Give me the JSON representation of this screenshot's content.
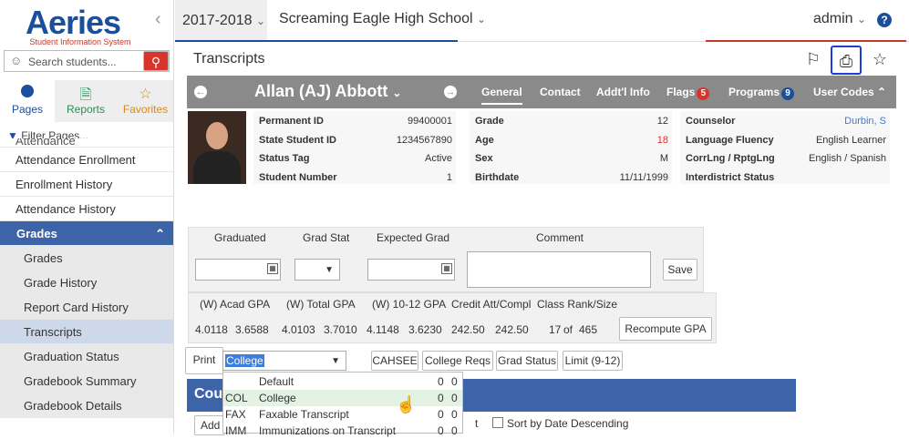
{
  "sidebar": {
    "logo_main": "Aeries",
    "logo_sub": "Student Information System",
    "search_placeholder": "Search students...",
    "tabs": [
      {
        "label": "Pages"
      },
      {
        "label": "Reports"
      },
      {
        "label": "Favorites"
      }
    ],
    "filter_placeholder": "Filter Pages...",
    "nav": [
      {
        "label": "Attendance",
        "type": "item"
      },
      {
        "label": "Attendance Enrollment",
        "type": "item"
      },
      {
        "label": "Enrollment History",
        "type": "item"
      },
      {
        "label": "Attendance History",
        "type": "item"
      },
      {
        "label": "Grades",
        "type": "header"
      },
      {
        "label": "Grades",
        "type": "sub"
      },
      {
        "label": "Grade History",
        "type": "sub"
      },
      {
        "label": "Report Card History",
        "type": "sub"
      },
      {
        "label": "Transcripts",
        "type": "sub-active"
      },
      {
        "label": "Graduation Status",
        "type": "sub"
      },
      {
        "label": "Gradebook Summary",
        "type": "sub"
      },
      {
        "label": "Gradebook Details",
        "type": "sub"
      }
    ]
  },
  "topbar": {
    "year": "2017-2018",
    "school": "Screaming Eagle High School",
    "user": "admin",
    "help": "?"
  },
  "page": {
    "title": "Transcripts"
  },
  "student": {
    "name": "Allan (AJ) Abbott",
    "tabs": [
      {
        "label": "General",
        "badge": ""
      },
      {
        "label": "Contact",
        "badge": ""
      },
      {
        "label": "Addt'l Info",
        "badge": ""
      },
      {
        "label": "Flags",
        "badge": "5"
      },
      {
        "label": "Programs",
        "badge": "9"
      },
      {
        "label": "User Codes",
        "badge": ""
      }
    ],
    "col1": [
      {
        "label": "Permanent ID",
        "value": "99400001"
      },
      {
        "label": "State Student ID",
        "value": "1234567890"
      },
      {
        "label": "Status Tag",
        "value": "Active"
      },
      {
        "label": "Student Number",
        "value": "1"
      }
    ],
    "col2": [
      {
        "label": "Grade",
        "value": "12"
      },
      {
        "label": "Age",
        "value": "18"
      },
      {
        "label": "Sex",
        "value": "M"
      },
      {
        "label": "Birthdate",
        "value": "11/11/1999"
      }
    ],
    "col3": [
      {
        "label": "Counselor",
        "value": "Durbin, S"
      },
      {
        "label": "Language Fluency",
        "value": "English Learner"
      },
      {
        "label": "CorrLng / RptgLng",
        "value": "English / Spanish"
      },
      {
        "label": "Interdistrict Status",
        "value": ""
      }
    ]
  },
  "graduation": {
    "headers": [
      "Graduated",
      "Grad Stat",
      "Expected Grad",
      "Comment"
    ],
    "save_label": "Save"
  },
  "gpa": {
    "headers": [
      "(W) Acad GPA",
      "(W) Total GPA",
      "(W) 10-12 GPA",
      "Credit Att/Compl",
      "Class Rank/Size"
    ],
    "values": [
      "4.0118",
      "3.6588",
      "4.0103",
      "3.7010",
      "4.1148",
      "3.6230",
      "242.50",
      "242.50",
      "17",
      "of",
      "465"
    ],
    "recompute_label": "Recompute GPA"
  },
  "print_row": {
    "print_label": "Print",
    "selected": "College",
    "buttons": [
      "CAHSEE",
      "College Reqs",
      "Grad Status",
      "Limit (9-12)"
    ]
  },
  "dropdown": [
    {
      "code": "",
      "name": "Default",
      "a": "0",
      "b": "0"
    },
    {
      "code": "COL",
      "name": "College",
      "a": "0",
      "b": "0"
    },
    {
      "code": "FAX",
      "name": "Faxable Transcript",
      "a": "0",
      "b": "0"
    },
    {
      "code": "IMM",
      "name": "Immunizations on Transcript",
      "a": "0",
      "b": "0"
    }
  ],
  "course": {
    "title": "Cou",
    "add_label": "Add",
    "sort_label": "Sort by Date Descending",
    "t_fragment": "t"
  },
  "colors": {
    "primary": "#3d63a8",
    "accent_red": "#d9342b",
    "highlight": "#1a3fd6"
  }
}
